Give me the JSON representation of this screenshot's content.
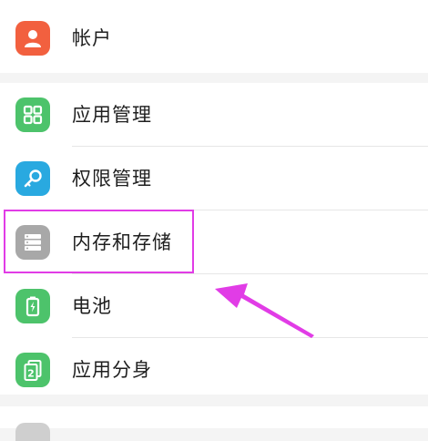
{
  "settings": {
    "items": [
      {
        "label": "帐户",
        "icon": "account-icon",
        "color": "#f2603f"
      },
      {
        "label": "应用管理",
        "icon": "app-management-icon",
        "color": "#4dc36b"
      },
      {
        "label": "权限管理",
        "icon": "key-permissions-icon",
        "color": "#29a9e0"
      },
      {
        "label": "内存和存储",
        "icon": "storage-icon",
        "color": "#9e9e9e"
      },
      {
        "label": "电池",
        "icon": "battery-icon",
        "color": "#4dc36b"
      },
      {
        "label": "应用分身",
        "icon": "app-clone-icon",
        "color": "#4dc36b"
      }
    ]
  },
  "annotation": {
    "highlight_color": "#e13ce6",
    "target": "内存和存储"
  }
}
